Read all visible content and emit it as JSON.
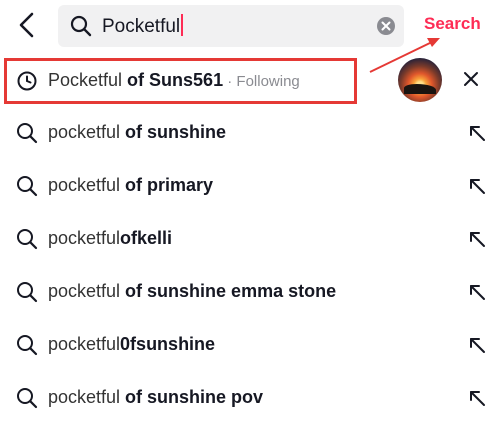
{
  "search": {
    "query": "Pocketful",
    "action_label": "Search"
  },
  "recent": {
    "prefix": "Pocketful",
    "bold": " of Suns561",
    "tag": " · Following"
  },
  "suggestions": [
    {
      "prefix": "pocketful",
      "bold": " of sunshine"
    },
    {
      "prefix": "pocketful",
      "bold": " of primary"
    },
    {
      "prefix": "pocketful",
      "bold": "ofkelli"
    },
    {
      "prefix": "pocketful",
      "bold": " of sunshine emma stone"
    },
    {
      "prefix": "pocketful",
      "bold": "0fsunshine"
    },
    {
      "prefix": "pocketful",
      "bold": " of sunshine pov"
    }
  ],
  "colors": {
    "accent": "#fe2c55",
    "annotation": "#e53935"
  },
  "icons": {
    "back": "chevron-left-icon",
    "search": "search-icon",
    "clear": "clear-circle-icon",
    "history": "clock-icon",
    "remove": "close-icon",
    "fill": "arrow-up-left-icon"
  }
}
